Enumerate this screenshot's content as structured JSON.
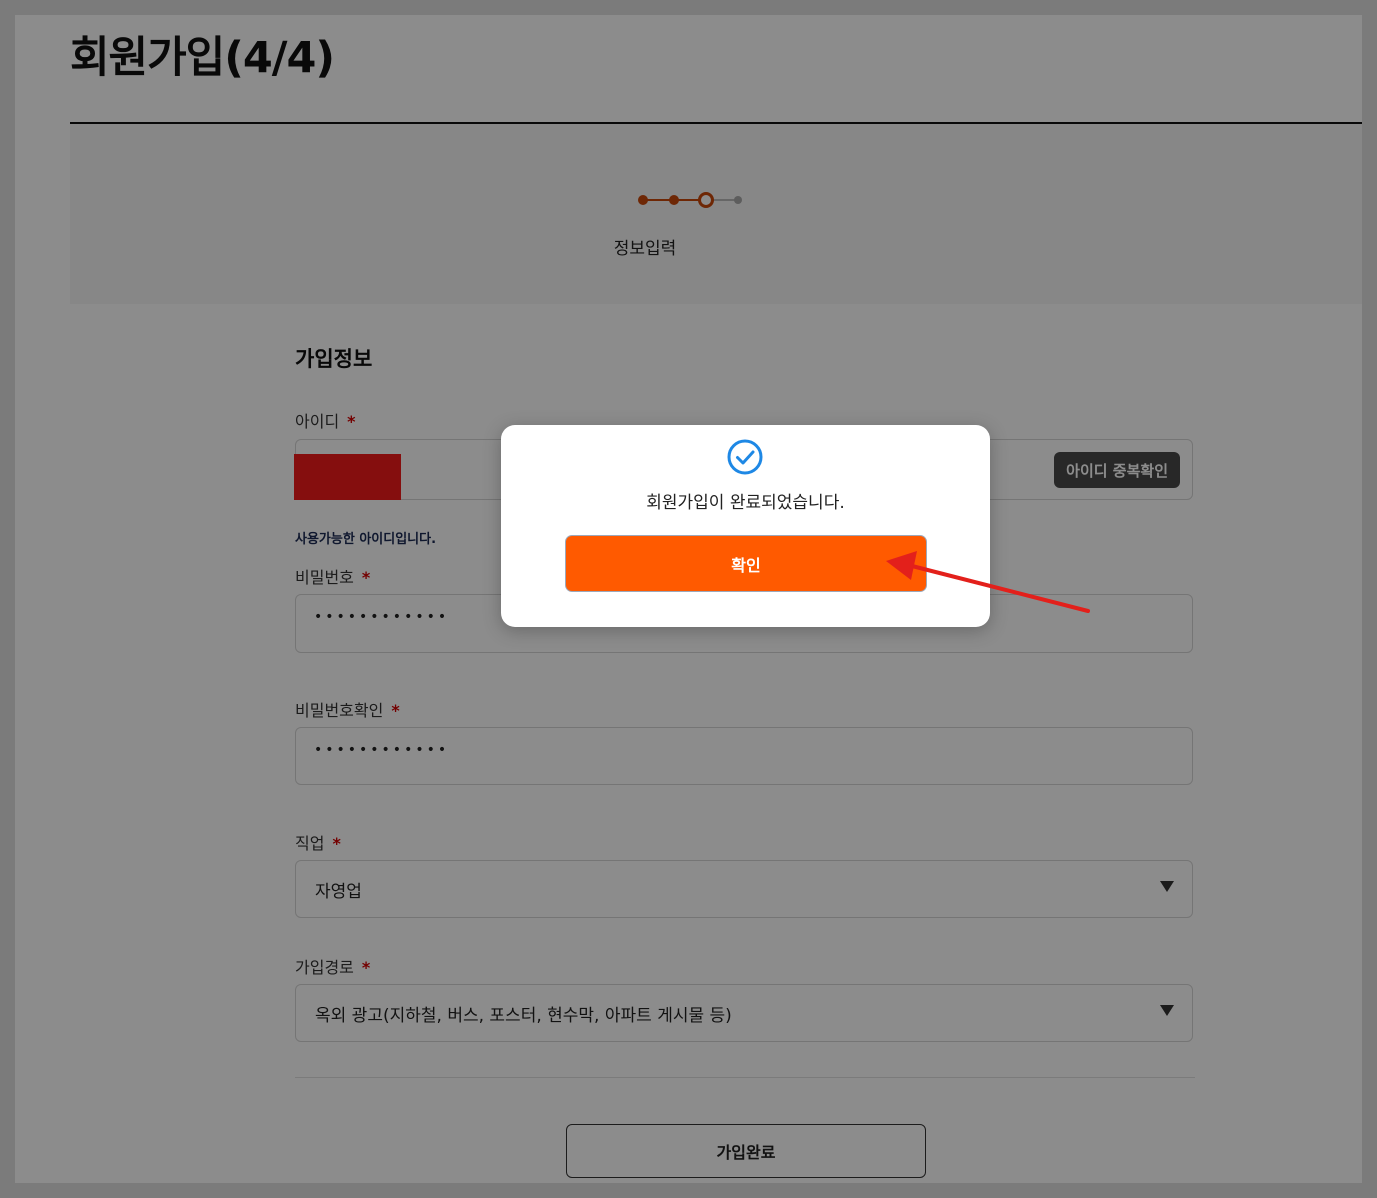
{
  "page": {
    "title": "회원가입(4/4)"
  },
  "stepper": {
    "current_label": "정보입력",
    "total_steps": 4,
    "current_step": 3
  },
  "form": {
    "section_title": "가입정보",
    "required_mark": "*",
    "user_id": {
      "label": "아이디",
      "value": "",
      "check_button": "아이디 중복확인",
      "helper": "사용가능한 아이디입니다."
    },
    "password": {
      "label": "비밀번호",
      "masked_value": "••••••••••••"
    },
    "password_confirm": {
      "label": "비밀번호확인",
      "masked_value": "••••••••••••"
    },
    "occupation": {
      "label": "직업",
      "selected": "자영업"
    },
    "signup_route": {
      "label": "가입경로",
      "selected": "옥외 광고(지하철, 버스, 포스터, 현수막, 아파트 게시물 등)"
    },
    "submit_label": "가입완료"
  },
  "modal": {
    "icon": "check-circle-icon",
    "message": "회원가입이 완료되었습니다.",
    "confirm_label": "확인"
  },
  "colors": {
    "accent": "#ff5a00",
    "step": "#c8470a",
    "required": "#d40000",
    "icon_blue": "#1e88e5",
    "annotation": "#e3201b",
    "redaction": "#f31b1b"
  }
}
